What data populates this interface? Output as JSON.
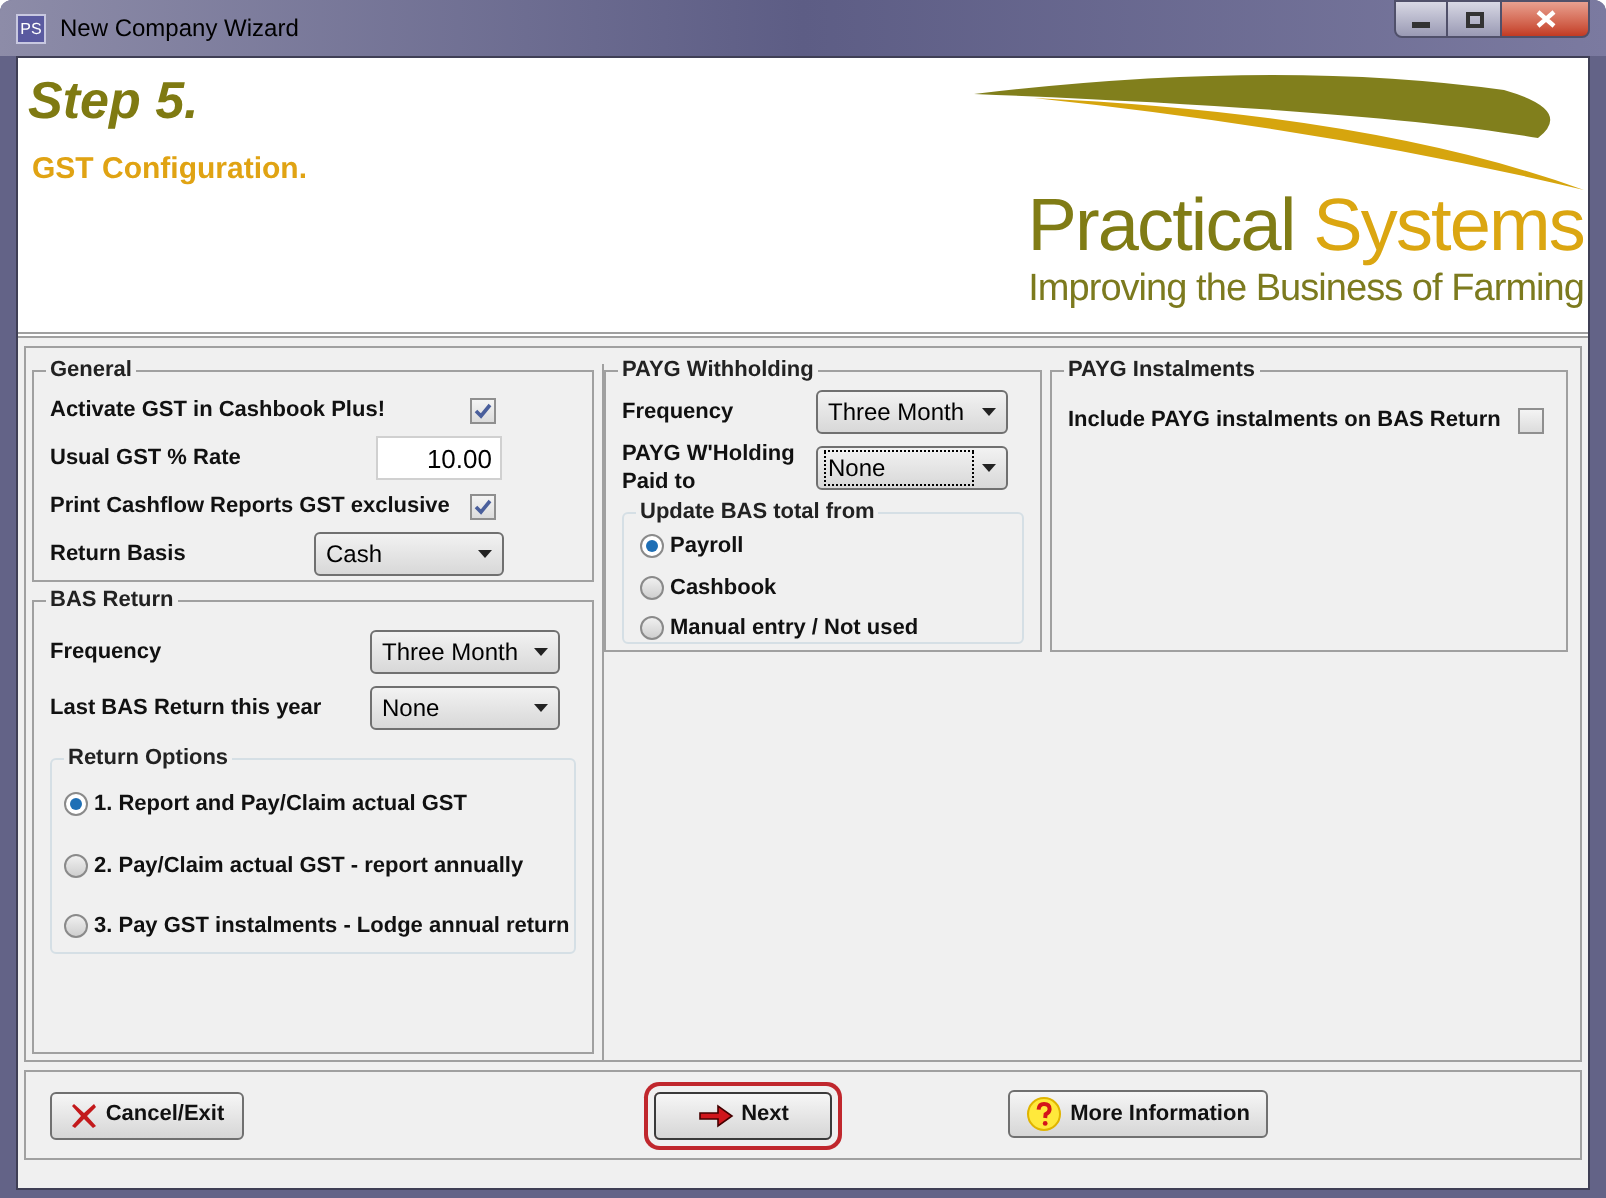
{
  "window": {
    "title": "New Company Wizard",
    "app_badge": "PS"
  },
  "header": {
    "step": "Step 5.",
    "subtitle": "GST Configuration.",
    "logo": {
      "word_1": "Practical",
      "word_2": "Systems",
      "tagline": "Improving the Business of Farming"
    }
  },
  "general": {
    "title": "General",
    "rows": [
      {
        "kind": "checkbox",
        "label": "Activate GST in Cashbook Plus!",
        "checked": true
      },
      {
        "kind": "input",
        "label": "Usual GST % Rate",
        "value": "10.00"
      },
      {
        "kind": "checkbox",
        "label": "Print Cashflow Reports GST exclusive",
        "checked": true
      },
      {
        "kind": "select",
        "label": "Return Basis",
        "value": "Cash",
        "focused": false
      }
    ]
  },
  "bas_return": {
    "title": "BAS Return",
    "rows": [
      {
        "kind": "select",
        "label": "Frequency",
        "value": "Three Month",
        "focused": false
      },
      {
        "kind": "select",
        "label": "Last BAS Return this year",
        "value": "None",
        "focused": false
      }
    ],
    "return_options": {
      "title": "Return Options",
      "options": [
        {
          "label": "1. Report and Pay/Claim actual GST",
          "selected": true
        },
        {
          "label": "2. Pay/Claim actual GST - report annually",
          "selected": false
        },
        {
          "label": "3. Pay GST instalments - Lodge annual return",
          "selected": false
        }
      ]
    }
  },
  "payg_withholding": {
    "title": "PAYG Withholding",
    "rows": [
      {
        "kind": "select",
        "label": "Frequency",
        "value": "Three Month",
        "focused": false
      },
      {
        "kind": "select",
        "label": "PAYG W'Holding Paid to",
        "value": "None",
        "focused": true
      }
    ],
    "update_bas": {
      "title": "Update BAS total from",
      "options": [
        {
          "label": "Payroll",
          "selected": true
        },
        {
          "label": "Cashbook",
          "selected": false
        },
        {
          "label": "Manual entry / Not used",
          "selected": false
        }
      ]
    }
  },
  "payg_instalments": {
    "title": "PAYG Instalments",
    "rows": [
      {
        "kind": "checkbox",
        "label": "Include PAYG instalments on BAS Return",
        "checked": false
      }
    ]
  },
  "buttons": [
    {
      "kind": "cancel",
      "label": "Cancel/Exit",
      "focused": false
    },
    {
      "kind": "next",
      "label": "Next",
      "focused": true
    },
    {
      "kind": "info",
      "label": "More Information",
      "focused": false
    }
  ]
}
